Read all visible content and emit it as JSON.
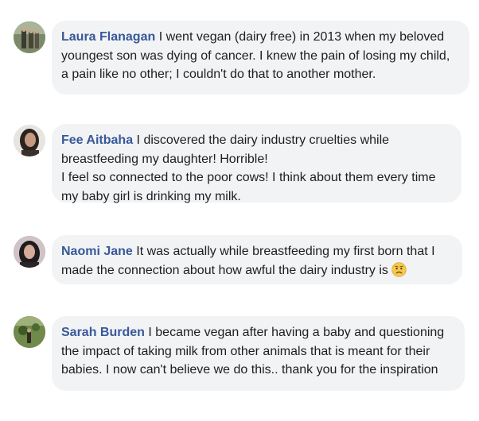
{
  "comments": [
    {
      "name": "Laura Flanagan",
      "text": "I went vegan (dairy free) in 2013 when my beloved youngest son was dying of cancer. I knew the pain of losing my child, a pain like no other; I couldn't do that to another mother.",
      "avatar": "avatar-outdoor-group"
    },
    {
      "name": "Fee Aitbaha",
      "text": "I discovered the dairy industry cruelties while breastfeeding my daughter! Horrible!\nI feel so connected to the poor cows! I think about them every time my baby girl is drinking my milk.",
      "avatar": "avatar-woman-portrait"
    },
    {
      "name": "Naomi Jane",
      "text": "It was actually while breastfeeding my first born that I made the connection about how awful the dairy industry is",
      "emoji": "worried-face-emoji",
      "avatar": "avatar-woman-dark-hair"
    },
    {
      "name": "Sarah Burden",
      "text": "I became vegan after having a baby and questioning the impact of taking milk from other animals that is meant for their babies. I now can't believe we do this.. thank you for the inspiration",
      "avatar": "avatar-field-scene"
    }
  ],
  "colors": {
    "name": "#385898",
    "text": "#1c1e21",
    "bubble": "#f2f3f5"
  }
}
